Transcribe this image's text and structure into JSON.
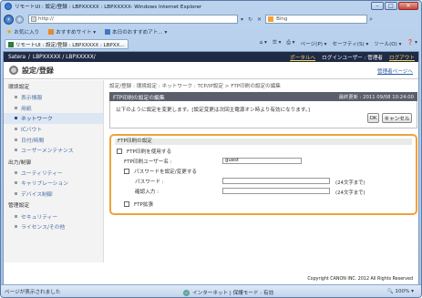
{
  "window": {
    "title": "リモートUI : 設定/登録 : LBPXXXXX : LBPXXXXX- Windows Internet Explorer",
    "minimize": "–",
    "maximize": "□",
    "close": "✕"
  },
  "address": {
    "url": "http://",
    "search_placeholder": "Bing"
  },
  "favorites": {
    "label": "お気に入り",
    "item1": "おすすめサイト ▾",
    "item2": "本日のおすすめアト... ▾"
  },
  "tab": {
    "label": "リモートUI : 設定/登録 : LBPXXXXX : LBPXX..."
  },
  "commandbar": {
    "page": "ページ(P) ▾",
    "safety": "セーフティ(S) ▾",
    "tools": "ツール(O) ▾",
    "help": "❓ ▾"
  },
  "header": {
    "brand": "Satera",
    "device": "LBPXXXXX / LBPXXXXX/",
    "portal_link": "ポータルへ",
    "login_user": "ログインユーザー : 管理者",
    "logout": "ログアウト"
  },
  "subheader": {
    "title": "設定/登録",
    "portal_link": "管理者ページへ"
  },
  "sidebar": {
    "sections": [
      {
        "label": "環境設定",
        "items": [
          {
            "label": "ページ",
            "partial": "表示情報"
          },
          {
            "label": "用紙"
          },
          {
            "label": "ネットワーク",
            "active": true
          },
          {
            "label": "ICバウト"
          },
          {
            "label": "日付/時間"
          },
          {
            "label": "ユーザーメンテナンス"
          }
        ]
      },
      {
        "label": "出力/制御",
        "items": [
          {
            "label": "ユーティリティー"
          },
          {
            "label": "キャリブレーション"
          },
          {
            "label": "デバイス制御"
          }
        ]
      },
      {
        "label": "管理設定",
        "items": [
          {
            "label": "セキュリティー"
          },
          {
            "label": "ライセンス/その他"
          }
        ]
      }
    ]
  },
  "main": {
    "breadcrumb": "設定/登録 : 環境設定 : ネットワーク : TCP/IP設定 > FTP印刷の設定の編集",
    "panel_title": "FTP印刷の設定の編集",
    "updated": "最終更新 : 2011 09/08 10:24:00",
    "message": "以下のように設定を変更します。[設定変更は次回主電源オン時より有効になります。]",
    "ok": "OK",
    "cancel": "キャンセル",
    "ftp_section": "FTP印刷の設定",
    "use_ftp": "FTP印刷を使用する",
    "username_label": "FTP印刷ユーザー名 :",
    "username_value": "guest",
    "set_password": "パスワードを設定/変更する",
    "password_label": "パスワード :",
    "confirm_label": "確認入力 :",
    "password_hint": "(24文字まで)",
    "confirm_hint": "(24文字まで)",
    "ftp_extension": "FTP拡張"
  },
  "footer": {
    "copyright": "Copyright CANON INC. 2012 All Rights Reserved"
  },
  "statusbar": {
    "status": "ページが表示されました",
    "zone": "インターネット | 保護モード : 有効",
    "zoom": "🔍 100% ▾"
  }
}
